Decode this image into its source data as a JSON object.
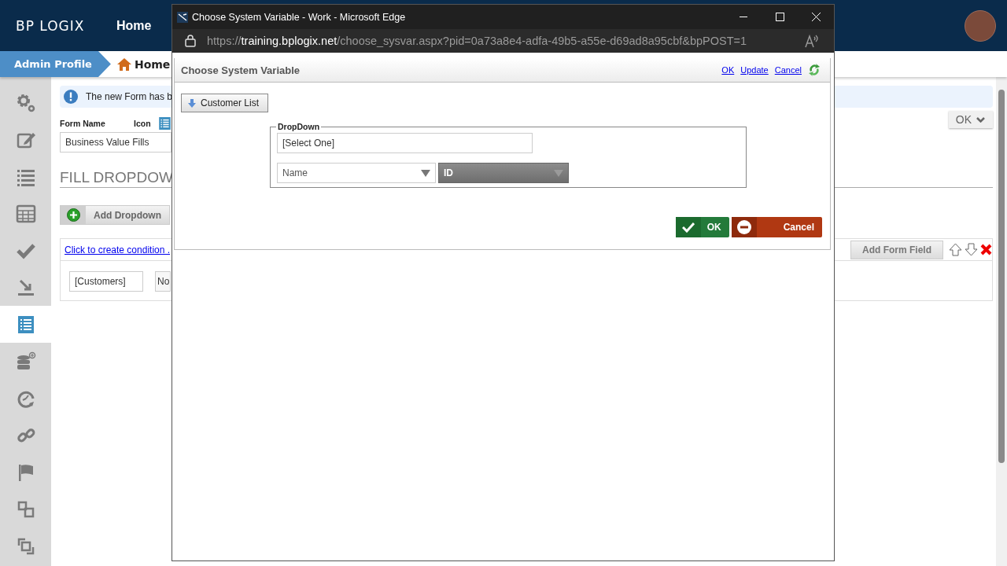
{
  "header": {
    "logo": "BP LOGIX",
    "nav": [
      {
        "label": "Home"
      }
    ]
  },
  "breadcrumb": [
    {
      "kind": "profile",
      "label": "Admin Profile"
    },
    {
      "kind": "home",
      "label": "Home"
    }
  ],
  "sidebar": {
    "items": [
      {
        "kind": "settings",
        "selected": false
      },
      {
        "kind": "edit",
        "selected": false
      },
      {
        "kind": "list",
        "selected": false
      },
      {
        "kind": "table",
        "selected": false
      },
      {
        "kind": "check",
        "selected": false
      },
      {
        "kind": "download",
        "selected": false
      },
      {
        "kind": "form",
        "selected": true
      },
      {
        "kind": "database",
        "selected": false
      },
      {
        "kind": "clock",
        "selected": false
      },
      {
        "kind": "link",
        "selected": false
      },
      {
        "kind": "flag",
        "selected": false
      },
      {
        "kind": "squares",
        "selected": false
      },
      {
        "kind": "copy",
        "selected": false
      }
    ]
  },
  "banner": {
    "text": "The new Form has b"
  },
  "form": {
    "name_label": "Form Name",
    "name_value": "Business Value Fills",
    "icon_label": "Icon",
    "menu_button": "OK"
  },
  "section": {
    "title": "FILL DROPDOW",
    "add_button": "Add Dropdown",
    "condition_link": "Click to create condition .",
    "add_field_button": "Add Form Field",
    "source_field": "[Customers]",
    "column_field": "No"
  },
  "popup": {
    "window_title": "Choose System Variable - Work - Microsoft Edge",
    "url": {
      "scheme": "https://",
      "host": "training.bplogix.net",
      "path": "/choose_sysvar.aspx?pid=0a73a8e4-adfa-49b5-a55e-d69ad8a95cbf&bpPOST=1"
    },
    "dialog_title": "Choose System Variable",
    "links": [
      "OK",
      "Update",
      "Cancel"
    ],
    "list_button": "Customer List",
    "group": {
      "legend": "DropDown",
      "value": "[Select One]",
      "selects": [
        {
          "value": "Name",
          "disabled": false
        },
        {
          "value": "ID",
          "disabled": true
        }
      ]
    },
    "buttons": [
      {
        "kind": "ok",
        "label": "OK"
      },
      {
        "kind": "cancel",
        "label": "Cancel"
      }
    ]
  }
}
